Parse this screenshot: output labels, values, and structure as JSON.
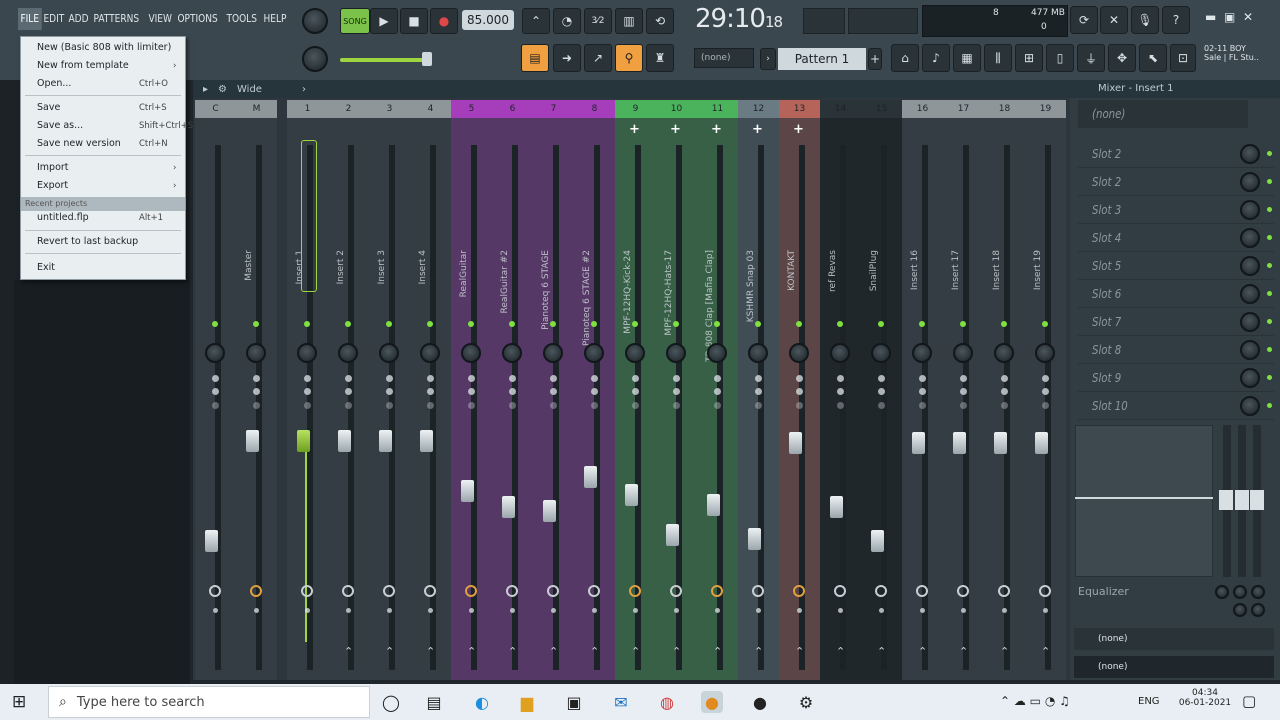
{
  "menubar": [
    "FILE",
    "EDIT",
    "ADD",
    "PATTERNS",
    "VIEW",
    "OPTIONS",
    "TOOLS",
    "HELP"
  ],
  "transport": {
    "song_label": "SONG",
    "tempo": "85.000",
    "time": "29:10",
    "time_sub": "18"
  },
  "cpu": {
    "mem": "477 MB",
    "voices": "0",
    "meter": "8"
  },
  "pattern": {
    "none_label": "(none)",
    "pattern_label": "Pattern 1"
  },
  "news": {
    "line1": "02-11 BOY",
    "line2": "Sale | FL Stu.."
  },
  "mixer": {
    "view_label": "Wide",
    "insert_panel_title": "Mixer - Insert 1",
    "channels": [
      {
        "num": "C",
        "name": "",
        "color": "#8e969a",
        "fader": 0.35
      },
      {
        "num": "M",
        "name": "Master",
        "color": "#8e969a",
        "fader": 0.85
      },
      {
        "num": "1",
        "name": "Insert 1",
        "color": "#8e969a",
        "fader": 0.85
      },
      {
        "num": "2",
        "name": "Insert 2",
        "color": "#8e969a",
        "fader": 0.85
      },
      {
        "num": "3",
        "name": "Insert 3",
        "color": "#8e969a",
        "fader": 0.85
      },
      {
        "num": "4",
        "name": "Insert 4",
        "color": "#8e969a",
        "fader": 0.85
      },
      {
        "num": "5",
        "name": "RealGuitar",
        "color": "#a63dba",
        "fader": 0.6
      },
      {
        "num": "6",
        "name": "RealGuitar #2",
        "color": "#a63dba",
        "fader": 0.52
      },
      {
        "num": "7",
        "name": "Pianoteq 6 STAGE",
        "color": "#a63dba",
        "fader": 0.5
      },
      {
        "num": "8",
        "name": "Pianoteq 6 STAGE #2",
        "color": "#a63dba",
        "fader": 0.67
      },
      {
        "num": "9",
        "name": "MPF-12HQ-Kick-24",
        "color": "#4cb35d",
        "fader": 0.58
      },
      {
        "num": "10",
        "name": "MPF-12HQ-Hats-17",
        "color": "#4cb35d",
        "fader": 0.38
      },
      {
        "num": "11",
        "name": "TR-808 Clap [Mafia Clap]",
        "color": "#4cb35d",
        "fader": 0.53
      },
      {
        "num": "12",
        "name": "KSHMR Snap 03",
        "color": "#6a7b84",
        "fader": 0.36
      },
      {
        "num": "13",
        "name": "KONTAKT",
        "color": "#b6635a",
        "fader": 0.84
      },
      {
        "num": "14",
        "name": "ref Revas",
        "color": "#3d464c",
        "fader": 0.52
      },
      {
        "num": "15",
        "name": "SnailPlug",
        "color": "#3d464c",
        "fader": 0.35
      },
      {
        "num": "16",
        "name": "Insert 16",
        "color": "#8e969a",
        "fader": 0.84
      },
      {
        "num": "17",
        "name": "Insert 17",
        "color": "#8e969a",
        "fader": 0.84
      },
      {
        "num": "18",
        "name": "Insert 18",
        "color": "#8e969a",
        "fader": 0.84
      },
      {
        "num": "19",
        "name": "Insert 19",
        "color": "#8e969a",
        "fader": 0.84
      }
    ],
    "slots": [
      "(none)",
      "Slot 2",
      "Slot 2",
      "Slot 3",
      "Slot 4",
      "Slot 5",
      "Slot 6",
      "Slot 7",
      "Slot 8",
      "Slot 9",
      "Slot 10"
    ],
    "equalizer_label": "Equalizer",
    "out_none_1": "(none)",
    "out_none_2": "(none)"
  },
  "file_menu": {
    "items": [
      {
        "label": "New (Basic 808 with limiter)",
        "shortcut": ""
      },
      {
        "label": "New from template",
        "shortcut": "›"
      },
      {
        "label": "Open...",
        "shortcut": "Ctrl+O"
      },
      {
        "label": "Save",
        "shortcut": "Ctrl+S"
      },
      {
        "label": "Save as...",
        "shortcut": "Shift+Ctrl+S"
      },
      {
        "label": "Save new version",
        "shortcut": "Ctrl+N"
      },
      {
        "label": "Import",
        "shortcut": "›"
      },
      {
        "label": "Export",
        "shortcut": "›"
      },
      {
        "label": "Recent projects",
        "shortcut": ""
      },
      {
        "label": "untitled.flp",
        "shortcut": "Alt+1"
      },
      {
        "label": "Revert to last backup",
        "shortcut": ""
      },
      {
        "label": "Exit",
        "shortcut": ""
      }
    ]
  },
  "taskbar": {
    "search_placeholder": "Type here to search",
    "lang": "ENG",
    "time": "04:34",
    "date": "06-01-2021"
  }
}
